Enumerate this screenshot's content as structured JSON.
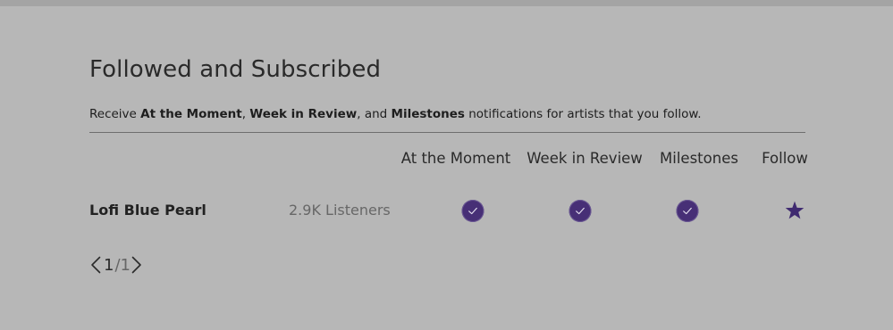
{
  "page": {
    "title": "Followed and Subscribed",
    "description": {
      "prefix": "Receive ",
      "item1": "At the Moment",
      "sep1": ", ",
      "item2": "Week in Review",
      "sep2": ", and ",
      "item3": "Milestones",
      "suffix": " notifications for artists that you follow."
    }
  },
  "table": {
    "columns": [
      {
        "label": "At the Moment"
      },
      {
        "label": "Week in Review"
      },
      {
        "label": "Milestones"
      },
      {
        "label": "Follow"
      }
    ],
    "rows": [
      {
        "artist": "Lofi Blue Pearl",
        "listeners": "2.9K Listeners",
        "at_the_moment": true,
        "week_in_review": true,
        "milestones": true,
        "follow": true
      }
    ]
  },
  "pagination": {
    "current": "1",
    "separator": "/",
    "total": "1"
  },
  "colors": {
    "background": "#b7b7b7",
    "accent": "#472f76",
    "text": "#2a2a2a",
    "muted": "#676767"
  },
  "icons": {
    "checked": "check-circle-icon",
    "follow": "star-icon",
    "prev": "chevron-left-icon",
    "next": "chevron-right-icon"
  }
}
